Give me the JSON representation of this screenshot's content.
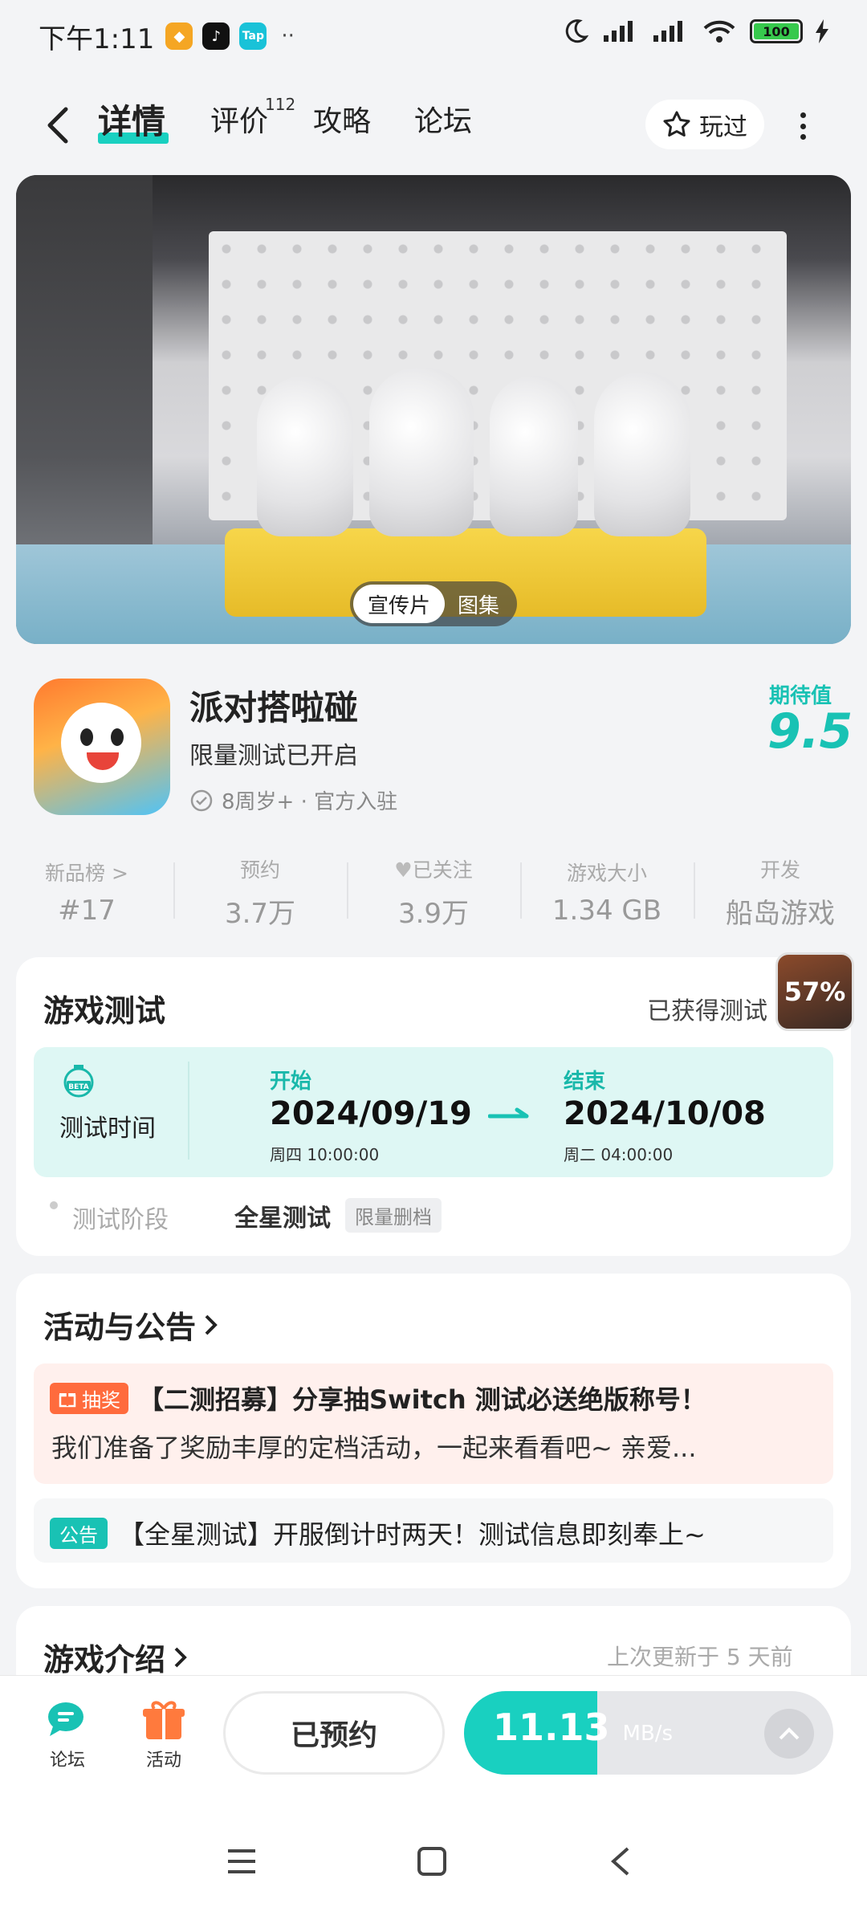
{
  "status_bar": {
    "time": "下午1:11",
    "battery": "100",
    "apps": [
      "Tap"
    ]
  },
  "header": {
    "tabs": [
      {
        "label": "详情",
        "active": true
      },
      {
        "label": "评价",
        "badge": "112"
      },
      {
        "label": "攻略"
      },
      {
        "label": "论坛"
      }
    ],
    "played_label": "玩过"
  },
  "banner": {
    "pill_active": "宣传片",
    "pill_other": "图集"
  },
  "game": {
    "title": "派对搭啦碰",
    "subtitle": "限量测试已开启",
    "meta": "8周岁+ · 官方入驻",
    "expect_label": "期待值",
    "expect_score": "9.5"
  },
  "stats": [
    {
      "label": "新品榜 >",
      "value": "#17"
    },
    {
      "label": "预约",
      "value": "3.7万"
    },
    {
      "label": "已关注",
      "value": "3.9万"
    },
    {
      "label": "游戏大小",
      "value": "1.34 GB"
    },
    {
      "label": "开发",
      "value": "船岛游戏"
    }
  ],
  "test": {
    "title": "游戏测试",
    "right_text": "已获得测试",
    "time_label": "测试时间",
    "start_label": "开始",
    "start_date": "2024/09/19",
    "start_sub": "周四  10:00:00",
    "end_label": "结束",
    "end_date": "2024/10/08",
    "end_sub": "周二  04:00:00",
    "stage_label": "测试阶段",
    "stage_value": "全星测试",
    "stage_tag": "限量删档"
  },
  "floating_progress": "57%",
  "activities": {
    "title": "活动与公告",
    "items": [
      {
        "tag": "抽奖",
        "title": "【二测招募】分享抽Switch 测试必送绝版称号！",
        "desc": "我们准备了奖励丰厚的定档活动，一起来看看吧~ 亲爱..."
      },
      {
        "tag": "公告",
        "title": "【全星测试】开服倒计时两天！测试信息即刻奉上~"
      }
    ]
  },
  "intro": {
    "title": "游戏介绍",
    "updated": "上次更新于 5 天前"
  },
  "bottom": {
    "forum": "论坛",
    "activity": "活动",
    "reserved": "已预约",
    "speed": "11.13",
    "speed_unit": "MB/s",
    "download_progress": 0.36
  },
  "colors": {
    "accent": "#19d0c0",
    "accent_text": "#19c2b4",
    "lottery": "#ff6b3d"
  }
}
